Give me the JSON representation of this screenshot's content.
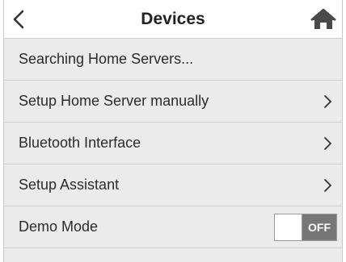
{
  "header": {
    "title": "Devices",
    "back_icon": "chevron-left-icon",
    "home_icon": "home-icon"
  },
  "menu": {
    "items": [
      {
        "label": "Searching Home Servers...",
        "has_chevron": false
      },
      {
        "label": "Setup Home Server manually",
        "has_chevron": true
      },
      {
        "label": "Bluetooth Interface",
        "has_chevron": true
      },
      {
        "label": "Setup Assistant",
        "has_chevron": true
      },
      {
        "label": "Demo Mode",
        "has_chevron": false
      }
    ]
  },
  "demo_mode": {
    "state_label": "OFF",
    "enabled": false
  },
  "colors": {
    "background": "#ebebeb",
    "header_background": "#ffffff",
    "toggle_off": "#777777",
    "text": "#2b2b2b"
  }
}
